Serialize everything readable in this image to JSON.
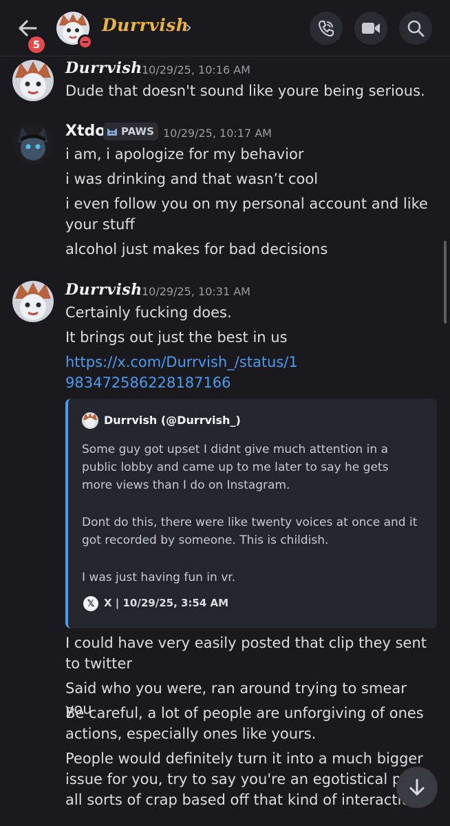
{
  "header": {
    "unread_count": "5",
    "contact_name": "Durrvish",
    "chevron": "›",
    "icons": [
      "back-arrow-icon",
      "phone-call-icon",
      "video-camera-icon",
      "search-icon"
    ],
    "status": "do-not-disturb"
  },
  "messages": [
    {
      "author": "Durrvish",
      "timestamp": "10/29/25, 10:16 AM",
      "lines": [
        "Dude that doesn't sound like youre being serious."
      ]
    },
    {
      "author": "Xtdo",
      "tag": "PAWS",
      "timestamp": "10/29/25, 10:17 AM",
      "lines": [
        "i am, i apologize for my behavior",
        "i was drinking and that wasn’t cool",
        "i even follow you on my personal account and like your stuff",
        "alcohol just makes for bad decisions"
      ]
    },
    {
      "author": "Durrvish",
      "timestamp": "10/29/25, 10:31 AM",
      "lines": [
        "Certainly fucking does.",
        "It brings out just the best in us"
      ],
      "link": "https://x.com/Durrvish_/status/1983472586228187166",
      "embed": {
        "author": "Durrvish (@Durrvish_)",
        "paragraphs": [
          "Some guy got upset I didnt give much attention in a public lobby and came up to me later to say he gets more views than I do on Instagram.",
          "Dont do this, there were like twenty voices at once and it got recorded by someone. This is childish.",
          "I was just having fun in vr."
        ],
        "footer": "X | 10/29/25, 3:54 AM",
        "accent_color": "#4a9cf0"
      },
      "followups": [
        "I could have very easily posted that clip they sent to twitter",
        "Said who you were, ran around trying to smear you",
        "Be careful, a lot of people are unforgiving of ones actions, especially ones like yours.",
        "People would definitely turn it into a much bigger issue for you, try to say you're an egotistical pers all sorts of crap based off that kind of interaction."
      ]
    }
  ],
  "colors": {
    "background": "#1a1a1e",
    "name_gold": "#e9b43c",
    "link": "#4a9cf0",
    "badge_red": "#e5484d"
  }
}
